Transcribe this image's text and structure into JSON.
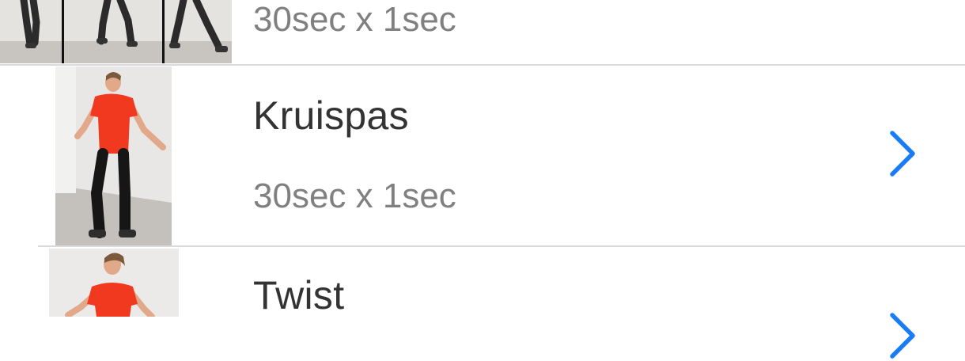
{
  "exercises": [
    {
      "title": "",
      "subtitle": "30sec x 1sec"
    },
    {
      "title": "Kruispas",
      "subtitle": "30sec x 1sec"
    },
    {
      "title": "Twist",
      "subtitle": ""
    }
  ],
  "icons": {
    "chevron": "chevron-right-icon"
  },
  "colors": {
    "accent": "#1a7cf5",
    "title": "#333333",
    "subtitle": "#808080",
    "separator": "#d9d9de"
  }
}
